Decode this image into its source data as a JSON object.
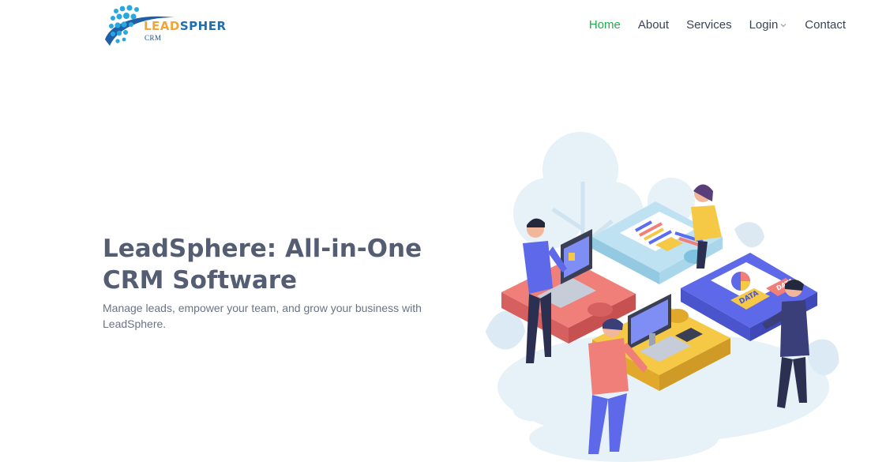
{
  "brand": {
    "logo_word_lead": "LEAD",
    "logo_word_rest": "SPHER",
    "logo_sub": "CRM"
  },
  "nav": {
    "items": [
      {
        "label": "Home",
        "active": true
      },
      {
        "label": "About"
      },
      {
        "label": "Services"
      },
      {
        "label": "Login",
        "dropdown": true
      },
      {
        "label": "Contact"
      }
    ]
  },
  "hero": {
    "title": "LeadSphere: All-in-One CRM Software",
    "subtitle": "Manage leads, empower your team, and grow your business with LeadSphere."
  },
  "illustration": {
    "tag_1": "DATA",
    "tag_2": "DATA"
  },
  "colors": {
    "active_nav": "#1fae4c",
    "title": "#545d72",
    "text": "#6b7386",
    "brand_blue": "#1f6fb2",
    "brand_orange": "#f2a533"
  }
}
